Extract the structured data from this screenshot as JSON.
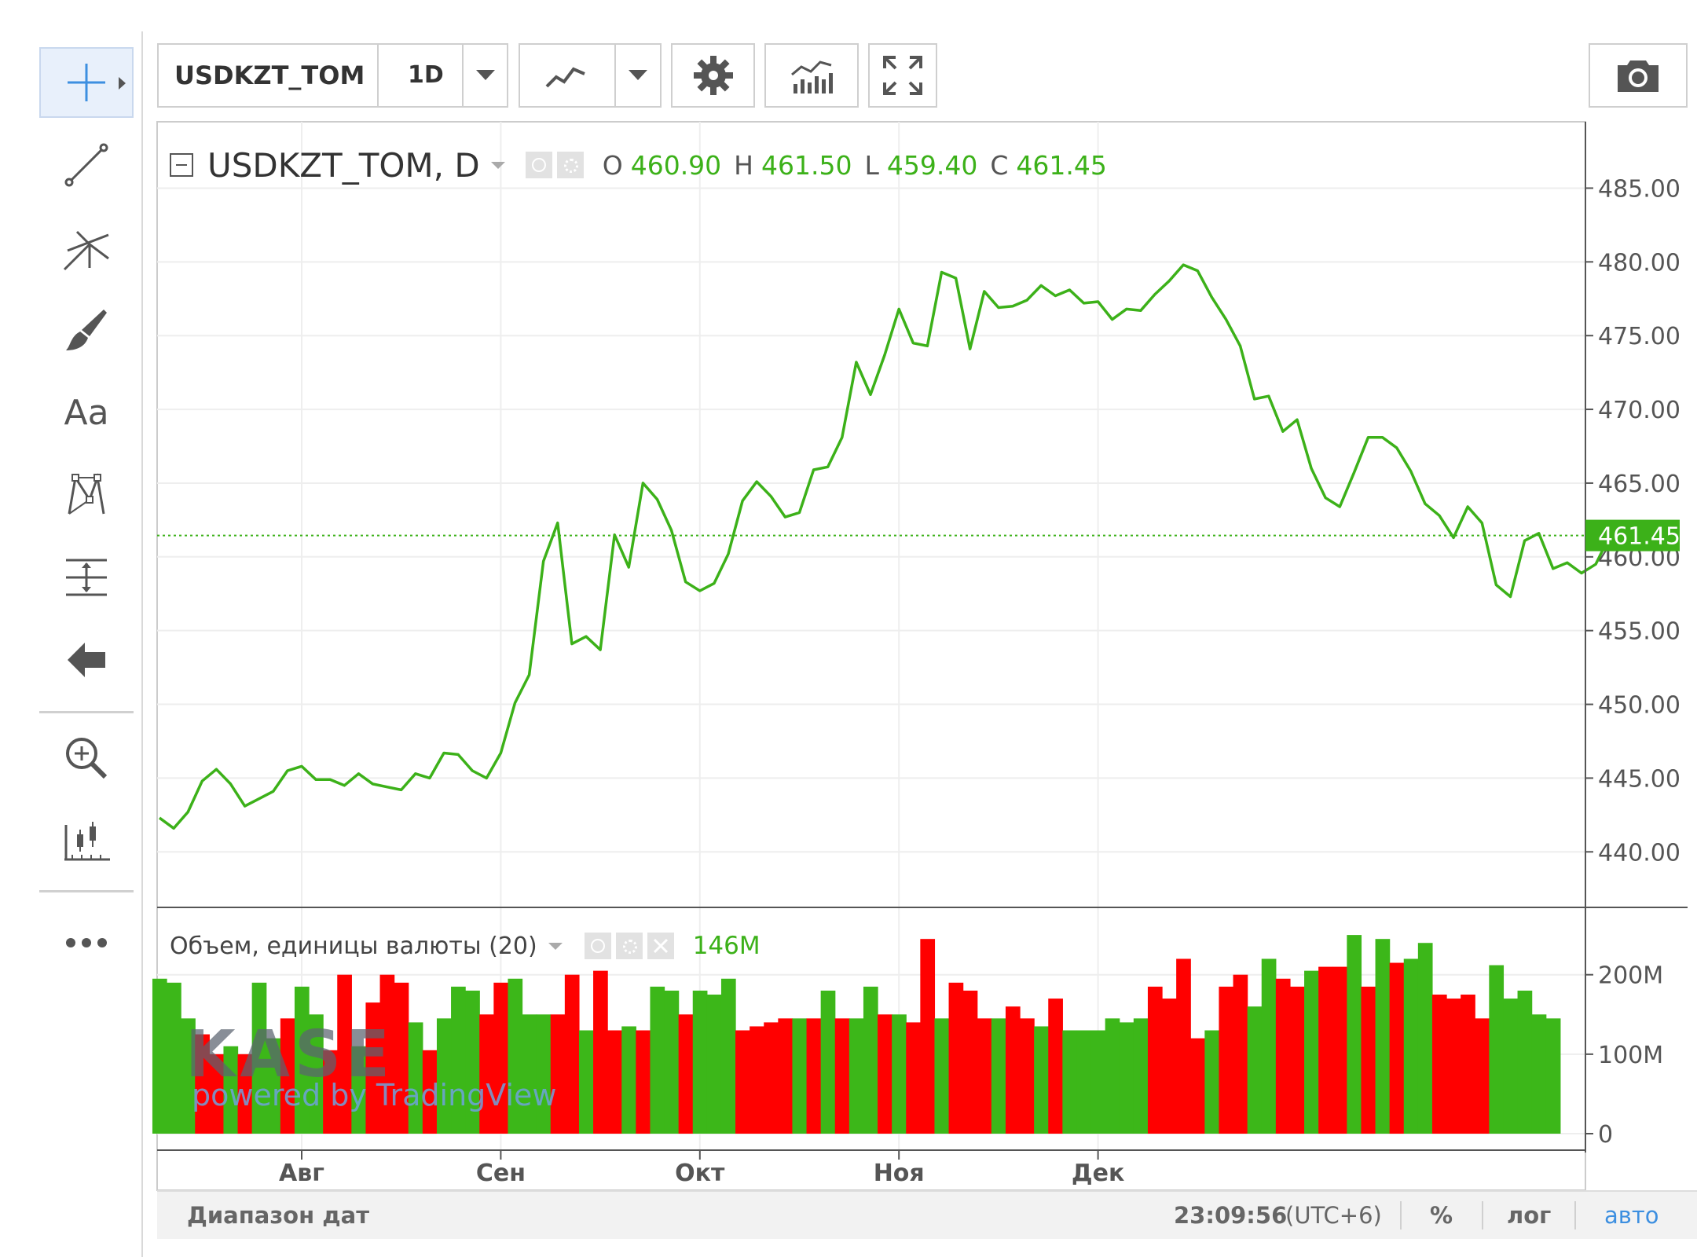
{
  "toolbar": {
    "symbol": "USDKZT_TOM",
    "interval": "1D",
    "tools": [
      "crosshair",
      "trend-line",
      "pitchfork",
      "brush",
      "text",
      "pattern",
      "measure",
      "back",
      "zoom",
      "bars"
    ],
    "text_tool_label": "Aa"
  },
  "legend": {
    "symbol_interval": "USDKZT_TOM, D",
    "o_label": "O",
    "o_value": "460.90",
    "h_label": "H",
    "h_value": "461.50",
    "l_label": "L",
    "l_value": "459.40",
    "c_label": "C",
    "c_value": "461.45"
  },
  "volume_legend": {
    "title": "Объем, единицы валюты (20)",
    "value": "146M"
  },
  "watermark": {
    "logo": "KASE",
    "powered": "powered by TradingView"
  },
  "status_bar": {
    "date_range": "Диапазон дат",
    "time": "23:09:56",
    "timezone": "(UTC+6)",
    "percent": "%",
    "log": "лог",
    "auto": "авто"
  },
  "colors": {
    "line": "#3cb119",
    "up_volume": "#3cb719",
    "down_volume": "#ff0000",
    "last_price_bg": "#3cb119",
    "accent_blue": "#3d8fe0",
    "grid": "#eeeeee"
  },
  "chart_data": [
    {
      "type": "line",
      "series": [
        {
          "name": "USDKZT_TOM",
          "values": [
            442.3,
            441.6,
            442.7,
            444.8,
            445.6,
            444.6,
            443.1,
            443.6,
            444.1,
            445.5,
            445.8,
            444.9,
            444.9,
            444.5,
            445.3,
            444.6,
            444.4,
            444.2,
            445.3,
            445.0,
            446.7,
            446.6,
            445.5,
            445.0,
            446.7,
            450.1,
            452.0,
            459.7,
            462.3,
            454.1,
            454.6,
            453.7,
            461.5,
            459.3,
            465.0,
            463.9,
            461.8,
            458.3,
            457.7,
            458.2,
            460.2,
            463.8,
            465.1,
            464.1,
            462.7,
            463.0,
            465.9,
            466.1,
            468.1,
            473.2,
            471.0,
            473.7,
            476.8,
            474.5,
            474.3,
            479.3,
            478.9,
            474.1,
            478.0,
            476.9,
            477.0,
            477.4,
            478.4,
            477.7,
            478.1,
            477.2,
            477.3,
            476.1,
            476.8,
            476.7,
            477.8,
            478.7,
            479.8,
            479.4,
            477.6,
            476.1,
            474.3,
            470.7,
            470.9,
            468.5,
            469.3,
            466.0,
            464.0,
            463.4,
            465.7,
            468.1,
            468.1,
            467.4,
            465.8,
            463.6,
            462.8,
            461.3,
            463.4,
            462.3,
            458.1,
            457.3,
            461.1,
            461.6,
            459.2,
            459.6,
            458.9,
            459.5,
            461.45
          ]
        }
      ],
      "x_ticks": [
        "Авг",
        "Сен",
        "Окт",
        "Ноя",
        "Дек"
      ],
      "x_tick_index": [
        10,
        24,
        38,
        52,
        66
      ],
      "y_ticks": [
        "440.00",
        "445.00",
        "450.00",
        "455.00",
        "460.00",
        "465.00",
        "470.00",
        "475.00",
        "480.00",
        "485.00"
      ],
      "ylim": [
        436.5,
        488.7
      ],
      "last_price": "461.45",
      "grid": true
    },
    {
      "type": "bar",
      "title": "Объем, единицы валюты (20)",
      "values": [
        195,
        190,
        145,
        125,
        100,
        110,
        100,
        190,
        120,
        145,
        185,
        150,
        105,
        200,
        110,
        165,
        200,
        190,
        140,
        105,
        145,
        185,
        180,
        150,
        190,
        195,
        150,
        150,
        150,
        200,
        130,
        205,
        130,
        135,
        130,
        185,
        180,
        150,
        180,
        175,
        195,
        130,
        135,
        140,
        145,
        145,
        145,
        180,
        145,
        145,
        185,
        150,
        150,
        140,
        245,
        145,
        190,
        180,
        145,
        145,
        160,
        145,
        135,
        170,
        130,
        130,
        130,
        145,
        140,
        145,
        185,
        170,
        220,
        120,
        130,
        185,
        200,
        160,
        220,
        195,
        185,
        205,
        210,
        210,
        250,
        185,
        245,
        215,
        220,
        240,
        175,
        170,
        175,
        145,
        212,
        170,
        180,
        150,
        145
      ],
      "up": [
        true,
        true,
        true,
        false,
        false,
        true,
        false,
        true,
        true,
        false,
        true,
        true,
        false,
        false,
        true,
        false,
        false,
        false,
        true,
        false,
        true,
        true,
        true,
        false,
        false,
        true,
        true,
        true,
        false,
        false,
        true,
        false,
        false,
        true,
        false,
        true,
        true,
        false,
        true,
        true,
        true,
        false,
        false,
        false,
        false,
        true,
        false,
        true,
        false,
        true,
        true,
        false,
        true,
        false,
        false,
        true,
        false,
        false,
        false,
        true,
        false,
        false,
        true,
        false,
        true,
        true,
        true,
        true,
        true,
        true,
        false,
        false,
        false,
        false,
        true,
        false,
        false,
        true,
        true,
        false,
        false,
        true,
        false,
        false,
        true,
        false,
        true,
        false,
        true,
        true,
        false,
        false,
        false,
        false,
        true,
        true,
        true,
        true,
        true
      ],
      "y_ticks": [
        "0",
        "100M",
        "200M"
      ],
      "ylim": [
        0,
        260
      ],
      "last_value": "146M"
    }
  ]
}
